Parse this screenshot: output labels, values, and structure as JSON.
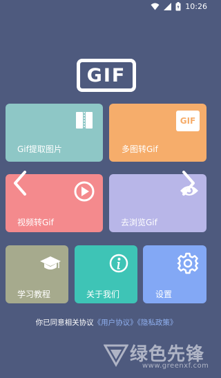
{
  "status": {
    "time": "10:26"
  },
  "logo": {
    "text": "GIF"
  },
  "tiles": {
    "extract": {
      "label": "Gif提取图片"
    },
    "multi": {
      "label": "多图转Gif",
      "badge": "GIF"
    },
    "video": {
      "label": "视频转Gif"
    },
    "browse": {
      "label": "去浏览Gif"
    },
    "learn": {
      "label": "学习教程"
    },
    "about": {
      "label": "关于我们"
    },
    "settings": {
      "label": "设置"
    }
  },
  "agreement": {
    "prefix": "你已同意相关协议",
    "user_link": "《用户协议》",
    "privacy_link": "《隐私政策》"
  },
  "watermark": {
    "cn": "绿色先锋",
    "url": "www.greenxf.com"
  },
  "colors": {
    "background": "#4e5a7e",
    "extract": "#8ec7c6",
    "multi": "#f6ad6b",
    "video": "#f48a8d",
    "browse": "#b8b6e8",
    "learn": "#a6aa8d",
    "about": "#3ec4b6",
    "settings": "#83a8f5",
    "link": "#8fb0f0"
  }
}
